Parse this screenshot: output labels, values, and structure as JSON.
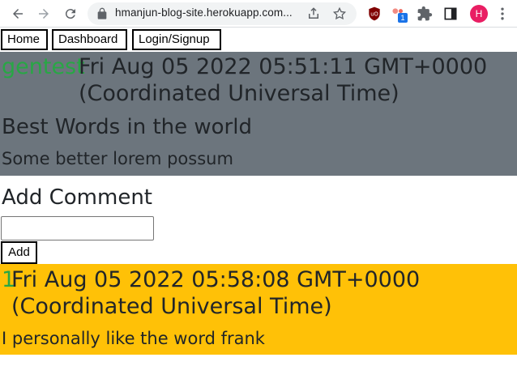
{
  "browser": {
    "url": "hmanjun-blog-site.herokuapp.com...",
    "badge_count": "1",
    "avatar_letter": "H"
  },
  "nav": {
    "home": "Home",
    "dashboard": "Dashboard",
    "login": "Login/Signup"
  },
  "post": {
    "author": "gentest",
    "date_line1": "Fri Aug 05 2022 05:51:11 GMT+0000",
    "date_line2": "(Coordinated Universal Time)",
    "title": "Best Words in the world",
    "body": "Some better lorem possum"
  },
  "add_comment": {
    "heading": "Add Comment",
    "input_value": "",
    "button_label": "Add"
  },
  "comments": [
    {
      "author": "1",
      "date_line1": "Fri Aug 05 2022 05:58:08 GMT+0000",
      "date_line2": "(Coordinated Universal Time)",
      "text": "I personally like the word frank"
    }
  ],
  "colors": {
    "post_bg": "#6c757d",
    "comment_bg": "#ffc107",
    "author_green": "#28a745"
  }
}
